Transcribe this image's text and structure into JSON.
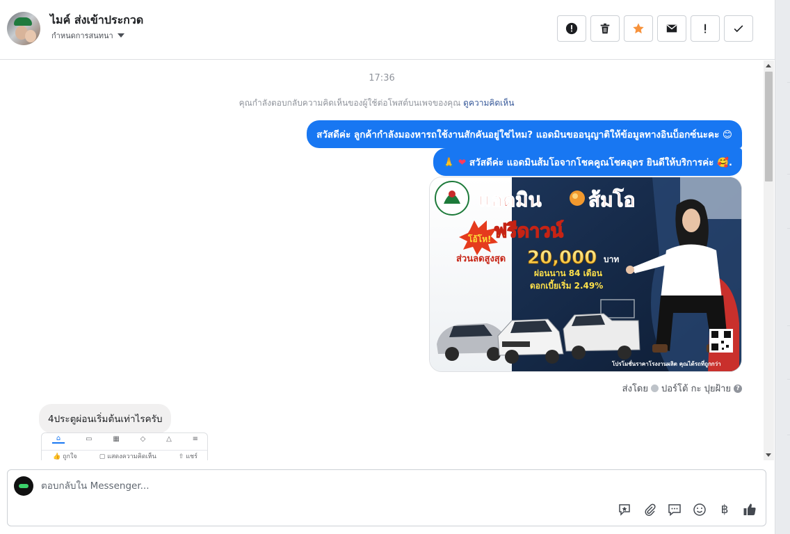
{
  "header": {
    "contact_name": "ไมค์ ส่งเข้าประกวด",
    "assign_label": "กำหนดการสนทนา",
    "tool_buttons": [
      "mark-spam",
      "delete",
      "star",
      "mark-unread",
      "follow-up",
      "mark-done"
    ]
  },
  "conversation": {
    "timestamp": "17:36",
    "notice_text": "คุณกำลังตอบกลับความคิดเห็นของผู้ใช้ต่อโพสต์บนเพจของคุณ",
    "notice_link": "ดูความคิดเห็น",
    "outgoing": [
      {
        "text": "สวัสดีค่ะ ลูกค้ากำลังมองหารถใช้งานสักคันอยู่ใช่ไหม? แอดมินขออนุญาติให้ข้อมูลทางอินบ็อกซ์นะคะ 😊"
      },
      {
        "prefix": "🙏",
        "heart": "❤",
        "text": " สวัสดีค่ะ แอดมินส้มโอจากโชคคูณโชคอุดร ยินดีให้บริการค่ะ 🥰."
      }
    ],
    "promo_image": {
      "title": "แอดมิน",
      "title2": "ส้มโอ",
      "badge": "โอ้โห!",
      "headline": "ฟรีดาวน์",
      "discount_label": "ส่วนลดสูงสุด",
      "discount_amount": "20,000",
      "discount_unit": "บาท",
      "installment": "ผ่อนนาน 84 เดือน",
      "interest": "ดอกเบี้ยเริ่ม 2.49%",
      "footer": "โปรโมชั่นราคาโรงงานผลิต คุณได้รถที่ถูกกว่า"
    },
    "sent_by_label": "ส่งโดย",
    "sent_by_name": "ปอร์โต้ กะ ปุยฝ้าย",
    "incoming": [
      {
        "text": "4ประตูผ่อนเริ่มต้นเท่าไรครับ"
      }
    ],
    "attachment_preview": {
      "action_like": "ถูกใจ",
      "action_comment": "แสดงความคิดเห็น",
      "action_share": "แชร์"
    }
  },
  "composer": {
    "placeholder": "ตอบกลับใน Messenger...",
    "tools": [
      "saved-reply",
      "attach",
      "chat-bubble",
      "emoji",
      "baht-payment",
      "like"
    ],
    "baht_symbol": "฿"
  },
  "colors": {
    "accent": "#1877f2",
    "star": "#f7923b",
    "incoming_bubble": "#f1f0f0"
  }
}
